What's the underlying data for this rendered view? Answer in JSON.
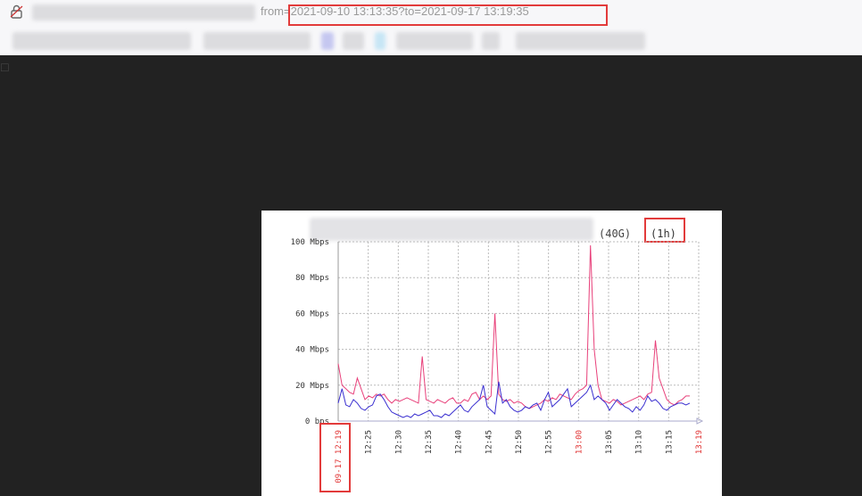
{
  "browser": {
    "url_text": "from=2021-09-10 13:13:35?to=2021-09-17 13:19:35",
    "icons": {
      "lock": "lock-icon",
      "bookmark": "bookmark-icon"
    }
  },
  "panel": {
    "title_suffix": "(40G)",
    "period": "(1h)"
  },
  "chart_data": {
    "type": "line",
    "yticks": [
      "100 Mbps",
      "80 Mbps",
      "60 Mbps",
      "40 Mbps",
      "20 Mbps",
      "0 bps"
    ],
    "ylim": [
      0,
      100
    ],
    "xticks": [
      {
        "label": "09-17 12:19",
        "red": true
      },
      {
        "label": "12:25",
        "red": false
      },
      {
        "label": "12:30",
        "red": false
      },
      {
        "label": "12:35",
        "red": false
      },
      {
        "label": "12:40",
        "red": false
      },
      {
        "label": "12:45",
        "red": false
      },
      {
        "label": "12:50",
        "red": false
      },
      {
        "label": "12:55",
        "red": false
      },
      {
        "label": "13:00",
        "red": true
      },
      {
        "label": "13:05",
        "red": false
      },
      {
        "label": "13:10",
        "red": false
      },
      {
        "label": "13:15",
        "red": false
      },
      {
        "label": "13:19",
        "red": true
      }
    ],
    "grid": true,
    "series": [
      {
        "color": "#e8407a",
        "values": [
          32,
          20,
          18,
          16,
          15,
          24,
          18,
          12,
          14,
          13,
          15,
          14,
          15,
          12,
          10,
          12,
          11,
          12,
          13,
          12,
          11,
          10,
          36,
          12,
          11,
          10,
          12,
          11,
          10,
          12,
          13,
          10,
          10,
          12,
          11,
          15,
          16,
          12,
          14,
          12,
          14,
          60,
          15,
          12,
          11,
          12,
          10,
          11,
          10,
          8,
          7,
          8,
          9,
          10,
          12,
          11,
          13,
          12,
          15,
          14,
          13,
          12,
          15,
          17,
          18,
          20,
          98,
          40,
          20,
          12,
          11,
          10,
          12,
          11,
          9,
          10,
          11,
          12,
          13,
          14,
          12,
          15,
          16,
          45,
          24,
          18,
          12,
          10,
          9,
          11,
          12,
          14,
          14
        ]
      },
      {
        "color": "#3a2fd0",
        "values": [
          10,
          18,
          9,
          8,
          12,
          10,
          7,
          6,
          8,
          9,
          14,
          15,
          12,
          8,
          5,
          4,
          3,
          2,
          3,
          2,
          4,
          3,
          4,
          5,
          6,
          3,
          3,
          2,
          4,
          3,
          5,
          7,
          9,
          6,
          5,
          8,
          10,
          12,
          20,
          8,
          6,
          4,
          22,
          10,
          12,
          8,
          6,
          5,
          6,
          8,
          7,
          9,
          10,
          6,
          12,
          16,
          8,
          10,
          12,
          15,
          18,
          8,
          10,
          12,
          14,
          16,
          20,
          12,
          14,
          12,
          10,
          6,
          9,
          12,
          10,
          8,
          7,
          5,
          8,
          6,
          9,
          14,
          11,
          12,
          10,
          7,
          6,
          8,
          9,
          10,
          10,
          9,
          10
        ]
      }
    ]
  }
}
